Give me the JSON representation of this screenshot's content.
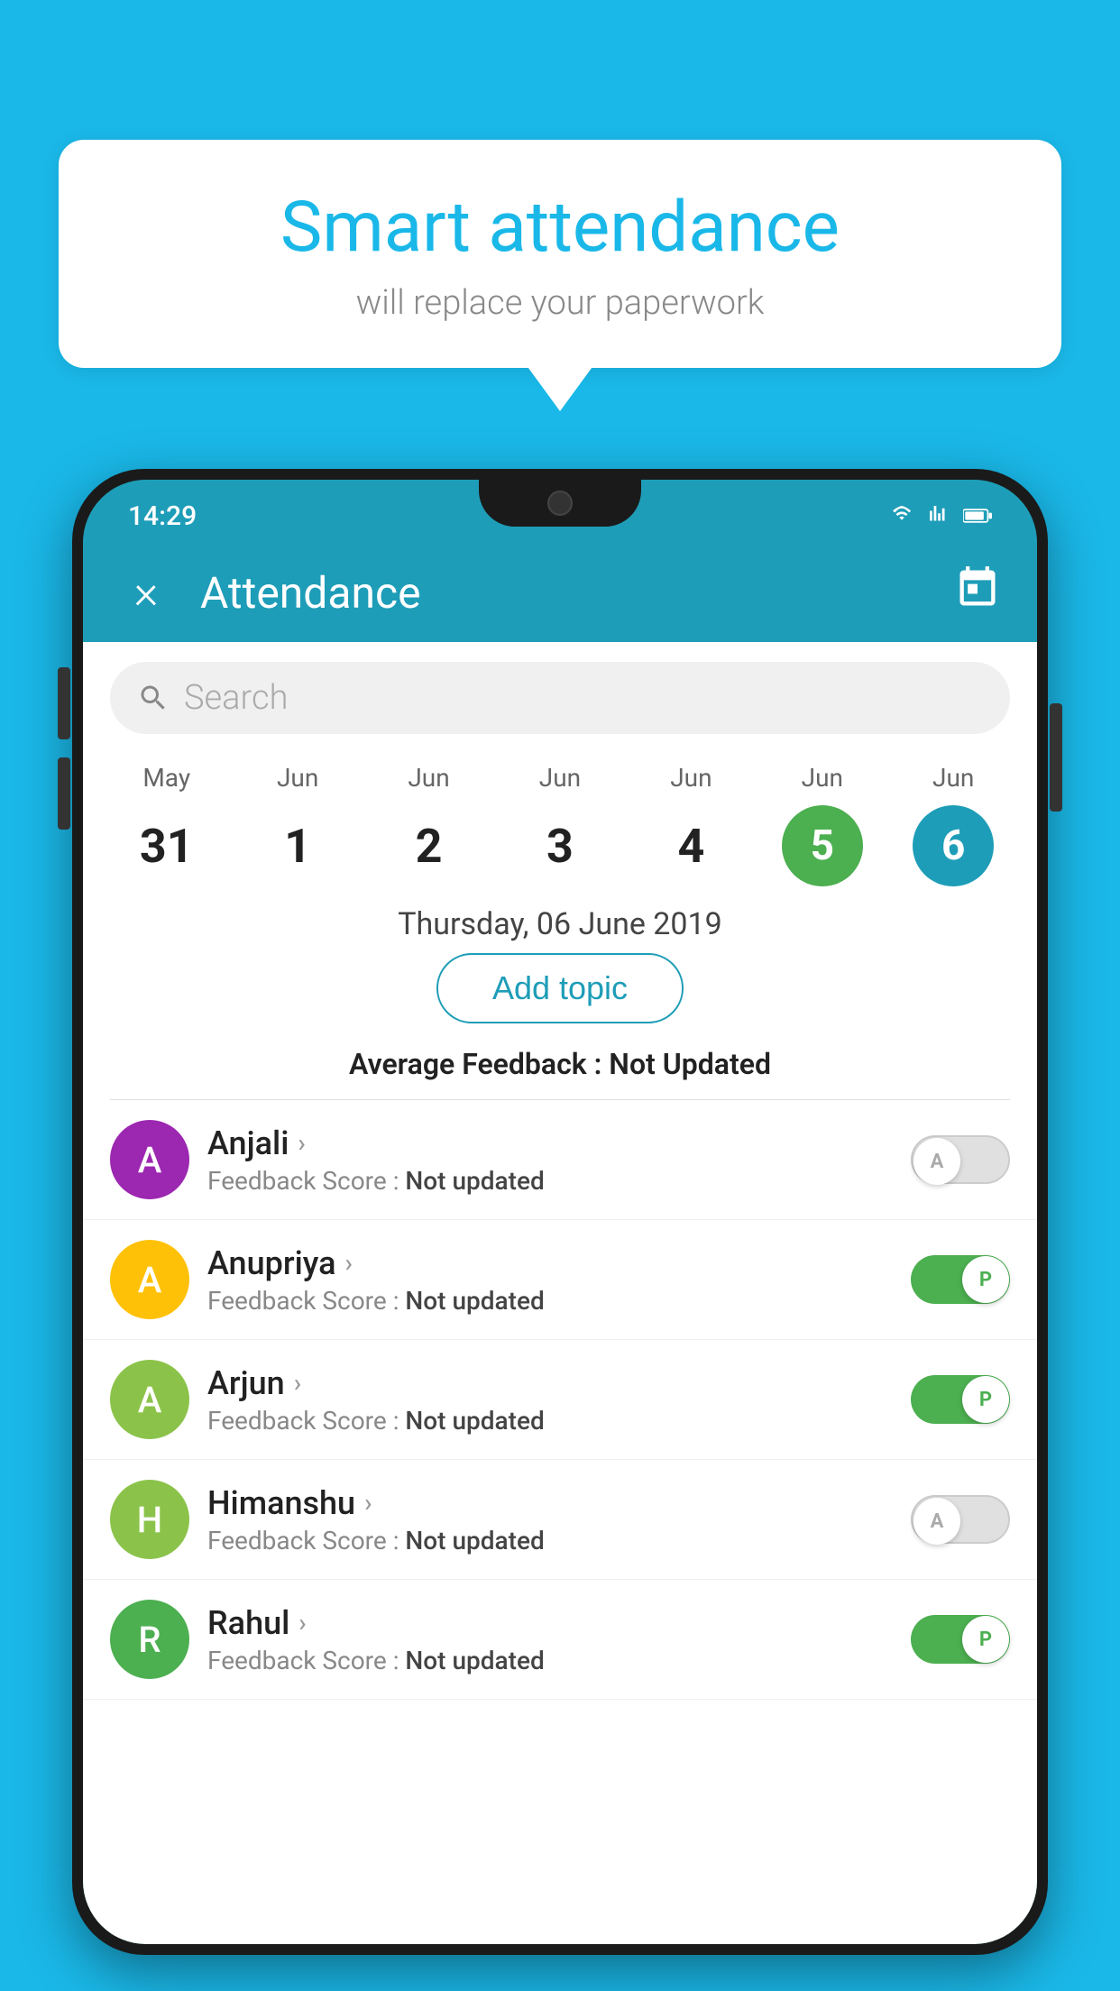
{
  "background_color": "#1ab8e8",
  "bubble": {
    "title": "Smart attendance",
    "subtitle": "will replace your paperwork"
  },
  "status_bar": {
    "time": "14:29"
  },
  "app_bar": {
    "title": "Attendance",
    "close_label": "×",
    "calendar_label": "📅"
  },
  "search": {
    "placeholder": "Search"
  },
  "calendar": {
    "days": [
      {
        "month": "May",
        "date": "31",
        "style": "normal"
      },
      {
        "month": "Jun",
        "date": "1",
        "style": "normal"
      },
      {
        "month": "Jun",
        "date": "2",
        "style": "normal"
      },
      {
        "month": "Jun",
        "date": "3",
        "style": "normal"
      },
      {
        "month": "Jun",
        "date": "4",
        "style": "normal"
      },
      {
        "month": "Jun",
        "date": "5",
        "style": "today"
      },
      {
        "month": "Jun",
        "date": "6",
        "style": "selected"
      }
    ]
  },
  "selected_date": "Thursday, 06 June 2019",
  "add_topic_label": "Add topic",
  "avg_feedback_label": "Average Feedback :",
  "avg_feedback_value": "Not Updated",
  "students": [
    {
      "name": "Anjali",
      "initial": "A",
      "avatar_color": "#9c27b0",
      "feedback_label": "Feedback Score :",
      "feedback_value": "Not updated",
      "toggle": "off",
      "toggle_label": "A"
    },
    {
      "name": "Anupriya",
      "initial": "A",
      "avatar_color": "#ffc107",
      "feedback_label": "Feedback Score :",
      "feedback_value": "Not updated",
      "toggle": "on",
      "toggle_label": "P"
    },
    {
      "name": "Arjun",
      "initial": "A",
      "avatar_color": "#8bc34a",
      "feedback_label": "Feedback Score :",
      "feedback_value": "Not updated",
      "toggle": "on",
      "toggle_label": "P"
    },
    {
      "name": "Himanshu",
      "initial": "H",
      "avatar_color": "#8bc34a",
      "feedback_label": "Feedback Score :",
      "feedback_value": "Not updated",
      "toggle": "off",
      "toggle_label": "A"
    },
    {
      "name": "Rahul",
      "initial": "R",
      "avatar_color": "#4caf50",
      "feedback_label": "Feedback Score :",
      "feedback_value": "Not updated",
      "toggle": "on",
      "toggle_label": "P"
    }
  ]
}
